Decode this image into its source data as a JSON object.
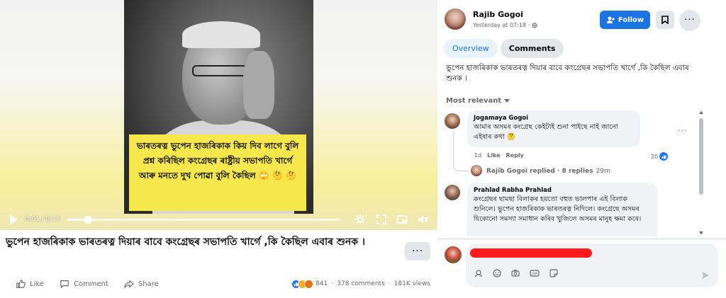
{
  "video": {
    "caption": "ভাৰতৰত্ন ভুপেন হাজৰিকাক কিয় দিব লাগে বুলি প্ৰশ্ন কৰিছিল কংগ্ৰেছৰ ৰাষ্ট্ৰীয় সভাপতি খাৰ্গে আৰু মনতে দুখ পোৱা বুলি কৈছিল 🙄 🤔 🤔",
    "time": "0:01 / 0:13",
    "progress": 0.0769
  },
  "post": {
    "title": "ভুপেন হাজৰিকাক ভাৰতৰত্ন দিয়াৰ বাবে কংগ্ৰেছৰ সভাপতি খাৰ্গে ,কি কৈছিল এবাৰ শুনক ।",
    "more_label": "···",
    "like_label": "Like",
    "comment_label": "Comment",
    "share_label": "Share",
    "reaction_count": "841",
    "comments_count": "378 comments",
    "views_count": "181K views"
  },
  "author": {
    "name": "Rajib Gogoi",
    "meta": "Yesterday at 07:18 ·",
    "follow_label": "Follow"
  },
  "tabs": [
    {
      "label": "Overview"
    },
    {
      "label": "Comments"
    }
  ],
  "side_description": "ভুপেন হাজৰিকাক ভাৰতৰত্ন দিয়াৰ বাবে কংগ্ৰেছৰ সভাপতি খাৰ্গে ,কি কৈছিল এবাৰ শুনক ।",
  "sort_label": "Most relevant",
  "comments": [
    {
      "name": "Jogamaya Gogoi",
      "text": "আমাৰ অসমৰ কংগ্ৰেছ কেইটাই শুনা পাইছে নাই জানো এইষাৰ কথা 🤔",
      "age": "1d",
      "like": "Like",
      "reply": "Reply",
      "likes": "20",
      "reply_summary_name": "Rajib Gogoi replied · 8 replies",
      "reply_summary_time": "29m"
    },
    {
      "name": "Prahlad Rabha Prahlad",
      "text": "কংগ্ৰেছৰ ছামছা বিলাকৰ হয়তো বহুত ভালপাৰ এই বিলাক শুনিলে। ভুপেন হাজৰিকাক ভাৰতৰত্ন নিদিলে। কংগ্ৰেছে অসমৰ যিকোনো সমস্যা সমাধান কৰিব খুজিলে অসমৰ মানুহ ক্ষমা কৰে।"
    }
  ],
  "composer": {
    "placeholder": ""
  },
  "colors": {
    "accent": "#1b74e4",
    "caption_bg": "#f5e74c",
    "redaction": "#ff1b1b"
  }
}
